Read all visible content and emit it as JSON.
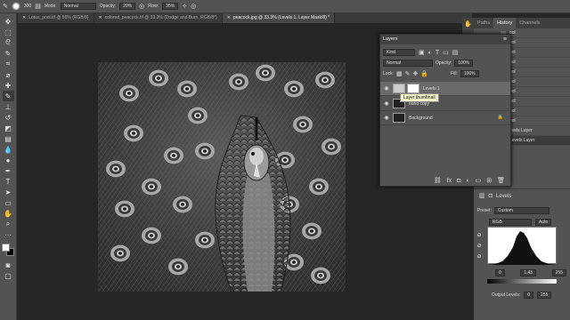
{
  "options_bar": {
    "brush_size": "300",
    "mode_label": "Mode:",
    "mode_value": "Normal",
    "opacity_label": "Opacity:",
    "opacity_value": "20%",
    "flow_label": "Flow:",
    "flow_value": "35%"
  },
  "doc_tabs": [
    {
      "label": "Lotus_pool.tif @ 50% (RGB/8)"
    },
    {
      "label": "colored_peacock.tif @ 33.3% (Dodge and Burn, RGB/8*)"
    },
    {
      "label": "peacock.jpg @ 33.3% (Levels 1, Layer Mask/8) *"
    }
  ],
  "right_panel": {
    "tabs": [
      "Paths",
      "History",
      "Channels"
    ],
    "history_items": [
      "ool",
      "ool",
      "ool",
      "ool",
      "ool",
      "ool",
      "ool",
      "ool",
      "ool",
      "ool",
      "evels Layer",
      "Levels Layer"
    ]
  },
  "layers_panel": {
    "title": "Layers",
    "kind_label": "Kind",
    "blend_mode": "Normal",
    "opacity_label": "Opacity:",
    "opacity_value": "100%",
    "lock_label": "Lock:",
    "fill_label": "Fill:",
    "fill_value": "100%",
    "layers": [
      {
        "name": "Levels 1"
      },
      {
        "name": "ound copy"
      },
      {
        "name": "Background"
      }
    ],
    "tooltip": "Layer thumbnail"
  },
  "properties": {
    "title": "Levels",
    "preset_label": "Preset:",
    "preset_value": "Custom",
    "channel_value": "RGB",
    "auto_label": "Auto",
    "input_low": "0",
    "input_mid": "1.43",
    "input_high": "255",
    "output_label": "Output Levels:",
    "output_low": "0",
    "output_high": "255"
  }
}
